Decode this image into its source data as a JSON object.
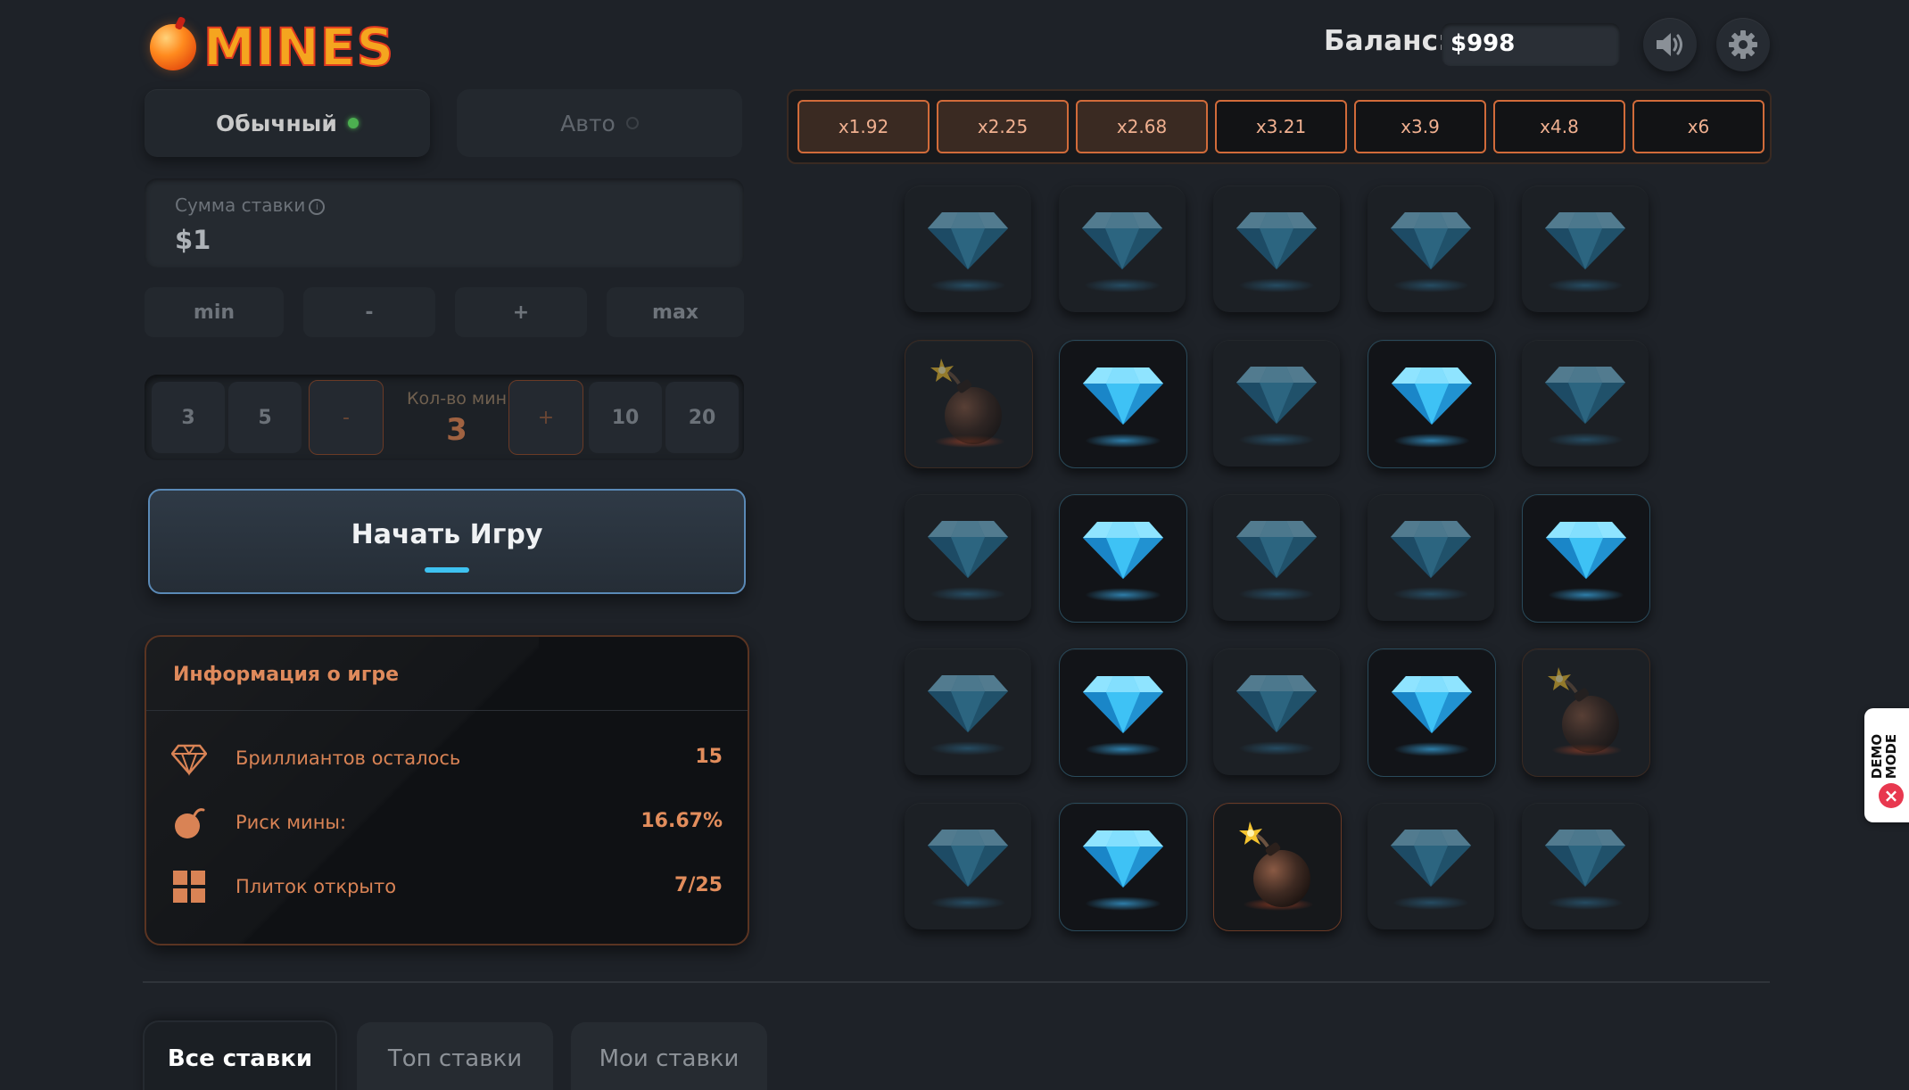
{
  "header": {
    "logo_text": "MINES",
    "balance_label": "Баланс:",
    "balance_value": "$998",
    "sound_icon": "speaker-icon",
    "settings_icon": "gear-icon"
  },
  "modes": {
    "manual_label": "Обычный",
    "auto_label": "Авто",
    "active": "manual"
  },
  "bet": {
    "label": "Сумма ставки",
    "value": "$1",
    "buttons": [
      "min",
      "-",
      "+",
      "max"
    ]
  },
  "mines": {
    "options_left": [
      "3",
      "5"
    ],
    "minus_label": "-",
    "count_label": "Кол-во мин",
    "count": "3",
    "plus_label": "+",
    "options_right": [
      "10",
      "20"
    ]
  },
  "start_button": {
    "label": "Начать Игру"
  },
  "info": {
    "title": "Информация о игре",
    "rows": [
      {
        "icon": "diamond-icon",
        "label": "Бриллиантов осталось",
        "value": "15"
      },
      {
        "icon": "bomb-icon",
        "label": "Риск мины:",
        "value": "16.67%"
      },
      {
        "icon": "grid-icon",
        "label": "Плиток открыто",
        "value": "7/25"
      }
    ]
  },
  "multipliers": [
    "x1.92",
    "x2.25",
    "x2.68",
    "x3.21",
    "x3.9",
    "x4.8",
    "x6"
  ],
  "multipliers_reached": 3,
  "grid": {
    "rows": 5,
    "cols": 5,
    "tiles": [
      [
        "diamond",
        "diamond",
        "diamond",
        "diamond",
        "diamond"
      ],
      [
        "bomb",
        "diamond-revealed",
        "diamond",
        "diamond-revealed",
        "diamond"
      ],
      [
        "diamond",
        "diamond-revealed",
        "diamond",
        "diamond",
        "diamond-revealed"
      ],
      [
        "diamond",
        "diamond-revealed",
        "diamond",
        "diamond-revealed",
        "bomb"
      ],
      [
        "diamond",
        "diamond-revealed",
        "bomb-hit",
        "diamond",
        "diamond"
      ]
    ]
  },
  "tabs": [
    "Все ставки",
    "Топ ставки",
    "Мои ставки"
  ],
  "active_tab": 0,
  "demo_badge": {
    "line1": "DEMO",
    "line2": "MODE"
  }
}
